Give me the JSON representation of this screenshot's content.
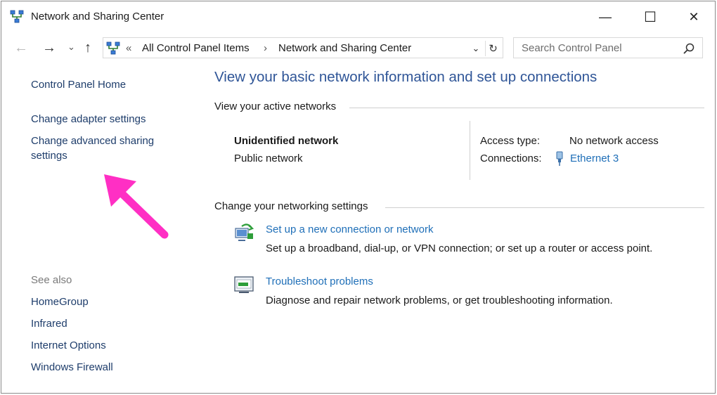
{
  "window": {
    "title": "Network and Sharing Center",
    "minimize_glyph": "—",
    "maximize_glyph": "☐",
    "close_glyph": "✕"
  },
  "navbar": {
    "back_glyph": "←",
    "forward_glyph": "→",
    "recent_glyph": "⌄",
    "up_glyph": "↑",
    "breadcrumb": {
      "overflow": "«",
      "items": [
        "All Control Panel Items",
        "Network and Sharing Center"
      ],
      "separator": "›"
    },
    "dropdown_glyph": "⌄",
    "refresh_glyph": "↻",
    "search_placeholder": "Search Control Panel"
  },
  "sidebar": {
    "home": "Control Panel Home",
    "links": [
      "Change adapter settings",
      "Change advanced sharing",
      "settings"
    ],
    "see_also_label": "See also",
    "see_also": [
      "HomeGroup",
      "Infrared",
      "Internet Options",
      "Windows Firewall"
    ]
  },
  "main": {
    "title": "View your basic network information and set up connections",
    "active_networks_heading": "View your active networks",
    "network": {
      "name": "Unidentified network",
      "category": "Public network",
      "access_type_label": "Access type:",
      "access_type_value": "No network access",
      "connections_label": "Connections:",
      "connection_value": "Ethernet 3"
    },
    "change_heading": "Change your networking settings",
    "tasks": [
      {
        "title": "Set up a new connection or network",
        "description": "Set up a broadband, dial-up, or VPN connection; or set up a router or access point."
      },
      {
        "title": "Troubleshoot problems",
        "description": "Diagnose and repair network problems, or get troubleshooting information."
      }
    ]
  },
  "colors": {
    "title_blue": "#2f5597",
    "link_blue": "#1f6fb8",
    "sidebar_link": "#1e3d6b",
    "annotation_arrow": "#ff2fc4"
  },
  "icons": [
    "network-center-icon",
    "search-icon",
    "ethernet-icon",
    "new-connection-icon",
    "troubleshoot-icon",
    "annotation-arrow"
  ]
}
